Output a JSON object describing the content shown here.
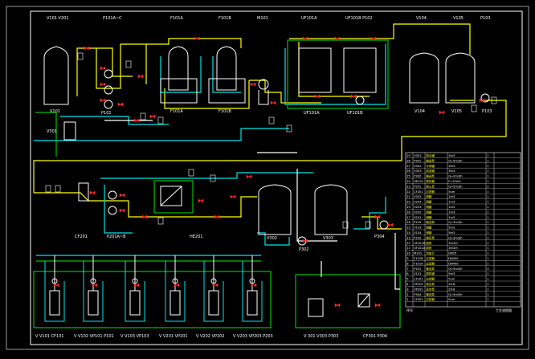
{
  "colors": {
    "background": "#000000",
    "frame": "#ffffff",
    "pipe_yellow": "#ffff00",
    "pipe_cyan": "#00e5e5",
    "pipe_green": "#00c000",
    "pipe_white": "#ffffff",
    "equipment": "#ffffff",
    "valve_red": "#ff2a2a",
    "label": "#ffffff",
    "sublabel": "#ffff00",
    "table_line": "#ffffff"
  },
  "header_tags": [
    {
      "id": "hdr-v101",
      "text": "V101 V201"
    },
    {
      "id": "hdr-p101",
      "text": "P101A~C"
    },
    {
      "id": "hdr-f101a",
      "text": "F101A"
    },
    {
      "id": "hdr-f101b",
      "text": "F101B"
    },
    {
      "id": "hdr-m101",
      "text": "M101"
    },
    {
      "id": "hdr-uf101a",
      "text": "UF101A"
    },
    {
      "id": "hdr-uf101b",
      "text": "UF101B  P102"
    },
    {
      "id": "hdr-v104",
      "text": "V104"
    },
    {
      "id": "hdr-v105",
      "text": "V105"
    },
    {
      "id": "hdr-p103",
      "text": "P103"
    }
  ],
  "equipment_labels": [
    {
      "id": "eq-v101",
      "text": "V101"
    },
    {
      "id": "eq-p101",
      "text": "P101"
    },
    {
      "id": "eq-f101a",
      "text": "F101A"
    },
    {
      "id": "eq-f101b",
      "text": "F101B"
    },
    {
      "id": "eq-uf101a",
      "text": "UF101A"
    },
    {
      "id": "eq-uf101b",
      "text": "UF101B"
    },
    {
      "id": "eq-v104",
      "text": "V104"
    },
    {
      "id": "eq-v105",
      "text": "V105"
    },
    {
      "id": "eq-p103",
      "text": "P103"
    },
    {
      "id": "eq-v301",
      "text": "V301"
    },
    {
      "id": "eq-cf201",
      "text": "CF201"
    },
    {
      "id": "eq-p201",
      "text": "P201A~B"
    },
    {
      "id": "eq-hx201",
      "text": "HE201"
    },
    {
      "id": "eq-v302",
      "text": "V302"
    },
    {
      "id": "eq-v303",
      "text": "V303"
    },
    {
      "id": "eq-p302",
      "text": "P302"
    },
    {
      "id": "eq-p304",
      "text": "P304"
    }
  ],
  "bottom_tags": [
    {
      "id": "bt-1",
      "text": "V V101  CF101"
    },
    {
      "id": "bt-2",
      "text": "V V102  VP101  P101"
    },
    {
      "id": "bt-3",
      "text": "V V103  VP103"
    },
    {
      "id": "bt-4",
      "text": "V V201  VP201"
    },
    {
      "id": "bt-5",
      "text": "V V202  VP202"
    },
    {
      "id": "bt-6",
      "text": "V V203  VP203  P203"
    },
    {
      "id": "bt-7",
      "text": "V 301  V303  P303"
    },
    {
      "id": "bt-8",
      "text": "CF301  P304"
    }
  ],
  "legend_table": {
    "rows": [
      {
        "no": "29",
        "tag": "V301",
        "name": "原水罐",
        "spec": "3m3",
        "qty": "1"
      },
      {
        "no": "28",
        "tag": "P301",
        "name": "输送泵",
        "spec": "Q=5m3/h",
        "qty": "1"
      },
      {
        "no": "27",
        "tag": "V302",
        "name": "中间罐",
        "spec": "3m3",
        "qty": "1"
      },
      {
        "no": "26",
        "tag": "V303",
        "name": "成品罐",
        "spec": "3m3",
        "qty": "1"
      },
      {
        "no": "25",
        "tag": "P302",
        "name": "输送泵",
        "spec": "Q=3m3/h",
        "qty": "1"
      },
      {
        "no": "24",
        "tag": "HE201",
        "name": "换热器",
        "spec": "F=10m2",
        "qty": "1"
      },
      {
        "no": "23",
        "tag": "P201",
        "name": "离心泵",
        "spec": "Q=5m3/h",
        "qty": "2"
      },
      {
        "no": "22",
        "tag": "CF201",
        "name": "过滤器",
        "spec": "5um",
        "qty": "1"
      },
      {
        "no": "21",
        "tag": "V205",
        "name": "储罐",
        "spec": "1m3",
        "qty": "1"
      },
      {
        "no": "20",
        "tag": "V204",
        "name": "储罐",
        "spec": "1m3",
        "qty": "1"
      },
      {
        "no": "19",
        "tag": "V203",
        "name": "储罐",
        "spec": "1m3",
        "qty": "1"
      },
      {
        "no": "18",
        "tag": "V202",
        "name": "储罐",
        "spec": "1m3",
        "qty": "1"
      },
      {
        "no": "17",
        "tag": "V201",
        "name": "储罐",
        "spec": "1m3",
        "qty": "1"
      },
      {
        "no": "16",
        "tag": "P103",
        "name": "输送泵",
        "spec": "Q=3m3/h",
        "qty": "1"
      },
      {
        "no": "15",
        "tag": "V105",
        "name": "储罐",
        "spec": "5m3",
        "qty": "1"
      },
      {
        "no": "14",
        "tag": "V104",
        "name": "储罐",
        "spec": "5m3",
        "qty": "1"
      },
      {
        "no": "13",
        "tag": "P102",
        "name": "增压泵",
        "spec": "Q=3m3/h",
        "qty": "1"
      },
      {
        "no": "12",
        "tag": "UF101B",
        "name": "超滤",
        "spec": "3m3/h",
        "qty": "1"
      },
      {
        "no": "11",
        "tag": "UF101A",
        "name": "超滤",
        "spec": "3m3/h",
        "qty": "1"
      },
      {
        "no": "10",
        "tag": "M101",
        "name": "流量计",
        "spec": "DN25",
        "qty": "1"
      },
      {
        "no": "9",
        "tag": "F101B",
        "name": "过滤器",
        "spec": "DN400",
        "qty": "1"
      },
      {
        "no": "8",
        "tag": "F101A",
        "name": "过滤器",
        "spec": "DN400",
        "qty": "1"
      },
      {
        "no": "7",
        "tag": "P101",
        "name": "输送泵",
        "spec": "Q=5m3/h",
        "qty": "3"
      },
      {
        "no": "6",
        "tag": "V101",
        "name": "原料罐",
        "spec": "5m3",
        "qty": "1"
      },
      {
        "no": "5",
        "tag": "CF101",
        "name": "过滤器",
        "spec": "5um",
        "qty": "1"
      },
      {
        "no": "4",
        "tag": "VP101",
        "name": "真空泵",
        "spec": "2X-8",
        "qty": "1"
      },
      {
        "no": "3",
        "tag": "VP201",
        "name": "真空泵",
        "spec": "2X-8",
        "qty": "1"
      },
      {
        "no": "2",
        "tag": "P304",
        "name": "输送泵",
        "spec": "Q=3m3/h",
        "qty": "1"
      },
      {
        "no": "1",
        "tag": "CF301",
        "name": "过滤器",
        "spec": "5um",
        "qty": "1"
      }
    ],
    "footer_left": "序号",
    "footer_right": "工艺流程图"
  }
}
